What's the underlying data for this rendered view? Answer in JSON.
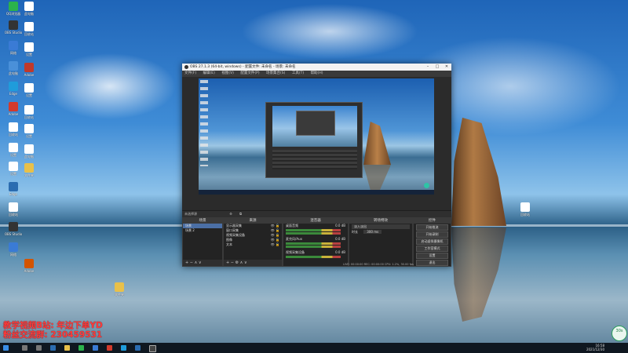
{
  "desktop": {
    "icons": [
      {
        "label": "QQ浏览器",
        "color": "#2bb24c"
      },
      {
        "label": "此电脑",
        "color": "#4a90d9"
      },
      {
        "label": "OBS Studio",
        "color": "#333333"
      },
      {
        "label": "网络",
        "color": "#3a7bd5"
      },
      {
        "label": "回收站",
        "color": "#88a0b8"
      },
      {
        "label": "Adobe",
        "color": "#d33a2c"
      },
      {
        "label": "Edge",
        "color": "#1f9cdb"
      },
      {
        "label": "设置",
        "color": "#666666"
      },
      {
        "label": "文件夹",
        "color": "#e8c04a"
      }
    ]
  },
  "obs": {
    "window_title": "OBS 27.1.3 (64-bit, windows) - 配置文件: 未命名 - 场景: 未命名",
    "menu": [
      "文件(F)",
      "编辑(E)",
      "视图(V)",
      "配置文件(P)",
      "场景集合(S)",
      "工具(T)",
      "帮助(H)"
    ],
    "scene_bar": "未选择源",
    "docks": {
      "scenes": {
        "title": "场景",
        "items": [
          "场景",
          "场景 2"
        ]
      },
      "sources": {
        "title": "来源",
        "items": [
          "显示器采集",
          "窗口采集",
          "视频采集设备",
          "图像",
          "文本"
        ]
      },
      "mixer": {
        "title": "混音器",
        "tracks": [
          {
            "name": "桌面音频",
            "level": "0.0 dB"
          },
          {
            "name": "麦克风/Aux",
            "level": "0.0 dB"
          },
          {
            "name": "视频采集设备",
            "level": "0.0 dB"
          }
        ]
      },
      "transitions": {
        "title": "转场特效",
        "type": "淡入淡出",
        "duration_label": "时长",
        "duration": "300 ms"
      },
      "controls": {
        "title": "控件",
        "buttons": [
          "开始推流",
          "开始录制",
          "启动虚拟摄像机",
          "工作室模式",
          "设置",
          "退出"
        ]
      }
    },
    "status": "LIVE: 00:00:00  REC: 00:00:00  CPU: 1.2%, 30.00 fps"
  },
  "overlay": {
    "line1": "教学视频B站: 年边下单YD",
    "line2": "粉丝交流群: 230459531"
  },
  "taskbar": {
    "time": "16:58",
    "date": "2021/12/30",
    "timer": "30s"
  }
}
